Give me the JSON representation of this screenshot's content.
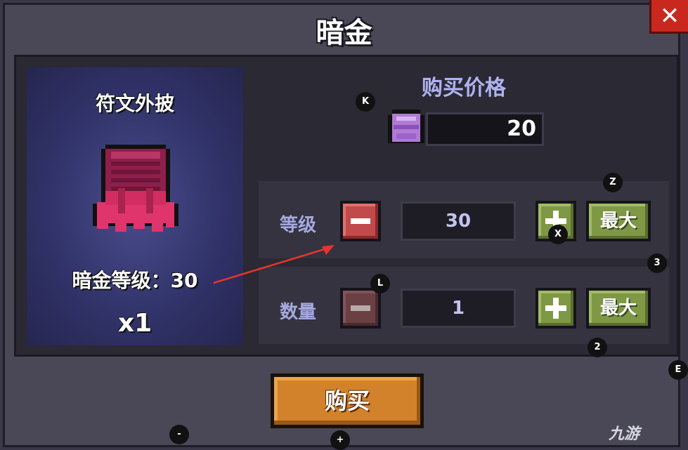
{
  "window": {
    "title": "暗金",
    "close_icon": "close-x-icon"
  },
  "item": {
    "name": "符文外披",
    "icon": "rune-cloak-icon",
    "level_text": "暗金等级：30",
    "count_text": "x1"
  },
  "price": {
    "title": "购买价格",
    "currency_icon": "purple-gem-icon",
    "value": "20"
  },
  "level_row": {
    "label": "等级",
    "value": "30",
    "max_label": "最大"
  },
  "quantity_row": {
    "label": "数量",
    "value": "1",
    "max_label": "最大"
  },
  "buy_button": {
    "label": "购买"
  },
  "key_hints": {
    "k": "K",
    "z": "Z",
    "x": "X",
    "three": "3",
    "l": "L",
    "two": "2",
    "e": "E",
    "minus": "-",
    "plus": "+"
  },
  "watermark": "九游",
  "colors": {
    "background": "#4a4856",
    "accent_text": "#a6a9e0",
    "minus_button": "#c14a4a",
    "plus_button": "#7f9846",
    "buy_button": "#d2822a",
    "close_button": "#c8281e"
  }
}
